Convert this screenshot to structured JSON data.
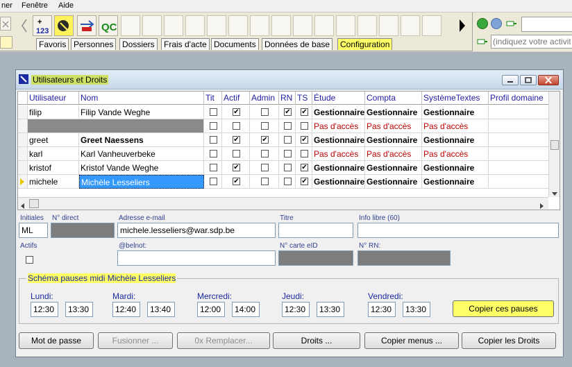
{
  "menu": {
    "items": [
      "ner",
      "Fenêtre",
      "Aide"
    ]
  },
  "toolbar": {
    "icons": [
      "back-chevron-icon",
      "calculator-123-icon",
      "wizard-tool-icon",
      "transfer-arrows-icon",
      "qc-icon"
    ],
    "qc_label": "QC",
    "calc_label": "123",
    "search_placeholder": "(indiquez votre activit"
  },
  "tabs": [
    "Favoris",
    "Personnes",
    "Dossiers",
    "Frais d'acte",
    "Documents",
    "Données de base",
    "Configuration"
  ],
  "active_tab": "Configuration",
  "window": {
    "title": "Utilisateurs et Droits"
  },
  "grid": {
    "columns": [
      "Utilisateur",
      "Nom",
      "Tit",
      "Actif",
      "Admin",
      "RN",
      "TS",
      "Étude",
      "Compta",
      "SystèmeTextes",
      "Profil domaine"
    ],
    "rows": [
      {
        "user": "filip",
        "name": "Filip Vande Weghe",
        "name_bold": false,
        "tit": false,
        "actif": true,
        "admin": false,
        "rn": true,
        "ts": true,
        "etude": "Gestionnaire",
        "compta": "Gestionnaire",
        "systeme": "Gestionnaire",
        "redacted": false,
        "selected": false
      },
      {
        "user": "",
        "name": "",
        "name_bold": false,
        "tit": false,
        "actif": false,
        "admin": false,
        "rn": false,
        "ts": false,
        "etude": "Pas d'accès",
        "compta": "Pas d'accès",
        "systeme": "Pas d'accès",
        "redacted": true,
        "selected": false
      },
      {
        "user": "greet",
        "name": "Greet Naessens",
        "name_bold": true,
        "tit": false,
        "actif": true,
        "admin": true,
        "rn": false,
        "ts": true,
        "etude": "Gestionnaire",
        "compta": "Gestionnaire",
        "systeme": "Gestionnaire",
        "redacted": false,
        "selected": false
      },
      {
        "user": "karl",
        "name": "Karl Vanheuverbeke",
        "name_bold": false,
        "tit": false,
        "actif": false,
        "admin": false,
        "rn": false,
        "ts": false,
        "etude": "Pas d'accès",
        "compta": "Pas d'accès",
        "systeme": "Pas d'accès",
        "redacted": false,
        "selected": false
      },
      {
        "user": "kristof",
        "name": "Kristof Vande Weghe",
        "name_bold": false,
        "tit": false,
        "actif": true,
        "admin": false,
        "rn": false,
        "ts": true,
        "etude": "Gestionnaire",
        "compta": "Gestionnaire",
        "systeme": "Gestionnaire",
        "redacted": false,
        "selected": false
      },
      {
        "user": "michele",
        "name": "Michèle Lesseliers",
        "name_bold": false,
        "tit": false,
        "actif": true,
        "admin": false,
        "rn": false,
        "ts": true,
        "etude": "Gestionnaire",
        "compta": "Gestionnaire",
        "systeme": "Gestionnaire",
        "redacted": false,
        "selected": true
      }
    ]
  },
  "form": {
    "initiales_label": "Initiales",
    "initiales_value": "ML",
    "ndirect_label": "N° direct",
    "email_label": "Adresse e-mail",
    "email_value": "michele.lesseliers@war.sdp.be",
    "titre_label": "Titre",
    "info_label": "Info libre (60)",
    "actifs_label": "Actifs",
    "belnot_label": "@belnot:",
    "carte_label": "N° carte eID",
    "rn_label": "N° RN:"
  },
  "schema": {
    "title": "Schéma pauses midi Michèle Lesseliers",
    "days": [
      {
        "name": "Lundi:",
        "start": "12:30",
        "end": "13:30"
      },
      {
        "name": "Mardi:",
        "start": "12:40",
        "end": "13:40"
      },
      {
        "name": "Mercredi:",
        "start": "12:00",
        "end": "14:00"
      },
      {
        "name": "Jeudi:",
        "start": "12:30",
        "end": "13:30"
      },
      {
        "name": "Vendredi:",
        "start": "12:30",
        "end": "13:30"
      }
    ],
    "copy_label": "Copier ces pauses"
  },
  "buttons": {
    "mot_de_passe": "Mot de passe",
    "fusionner": "Fusionner ...",
    "remplacer": "0x Remplacer...",
    "droits": "Droits ...",
    "copier_menus": "Copier menus ...",
    "copier_droits": "Copier les Droits"
  },
  "colors": {
    "highlight": "#ffff66",
    "selection": "#3399ff",
    "no_access": "#c00000"
  }
}
